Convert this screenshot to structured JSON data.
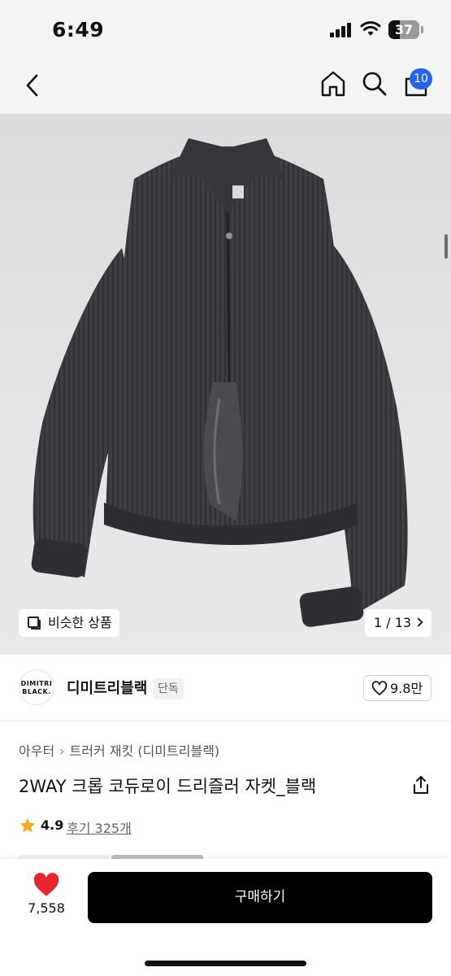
{
  "status_bar": {
    "time": "6:49",
    "battery_level": "37",
    "battery_percent": 37
  },
  "nav": {
    "cart_badge": "10"
  },
  "product_image": {
    "similar_label": "비슷한 상품",
    "page_counter": "1 / 13"
  },
  "brand": {
    "logo_text": "DIMITRI BLACK.",
    "name": "디미트리블랙",
    "tag": "단독",
    "like_count": "9.8만"
  },
  "breadcrumb": {
    "category": "아우터",
    "subcategory": "트러커 재킷 (디미트리블랙)"
  },
  "product": {
    "title": "2WAY 크롭 코듀로이 드리즐러 자켓_블랙"
  },
  "rating": {
    "score": "4.9",
    "reviews": "후기 325개"
  },
  "bottom_bar": {
    "wish_count": "7,558",
    "buy_label": "구매하기"
  },
  "colors": {
    "brand_blue": "#2563eb",
    "heart_red": "#e8262e",
    "star_orange": "#f5a623",
    "buy_button": "#000000"
  }
}
